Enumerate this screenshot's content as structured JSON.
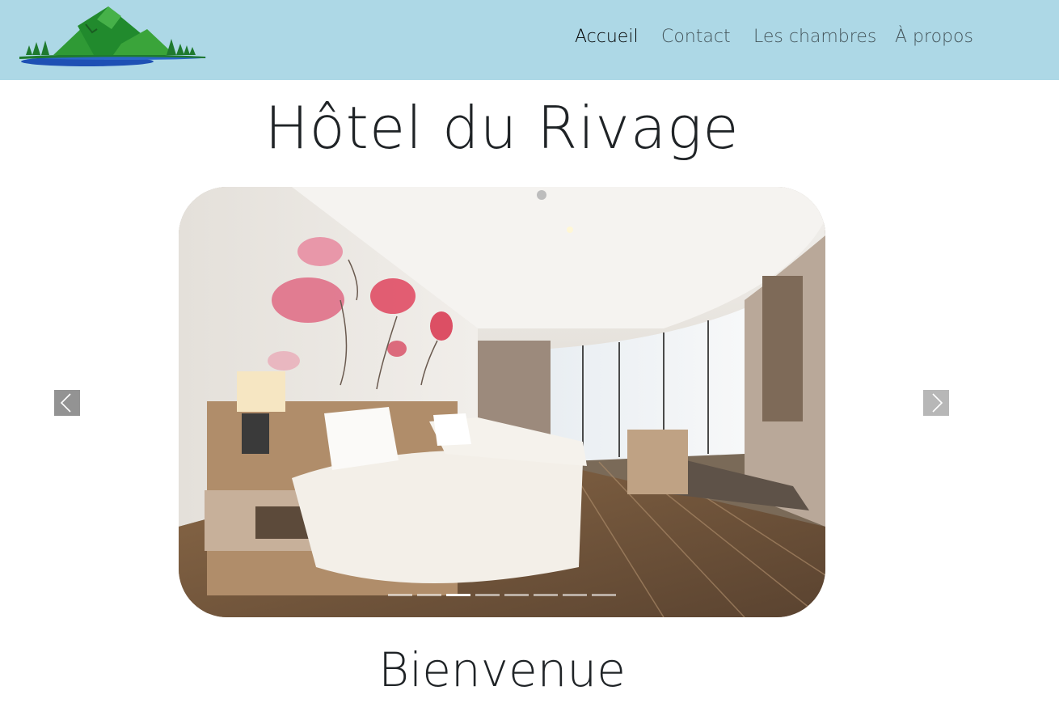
{
  "header": {
    "logo": {
      "icon": "mountain-lake-logo",
      "colors": {
        "mountain": "#2e8b2e",
        "water": "#1e50b4",
        "trees": "#1f7a2e"
      }
    },
    "nav": [
      {
        "label": "Accueil",
        "active": true
      },
      {
        "label": "Contact",
        "active": false
      },
      {
        "label": "Les chambres",
        "active": false
      },
      {
        "label": "À propos",
        "active": false
      }
    ],
    "background": "#add8e6"
  },
  "main": {
    "title": "Hôtel du Rivage",
    "carousel": {
      "slide_count": 8,
      "active_index": 2,
      "prev_icon": "chevron-left-icon",
      "next_icon": "chevron-right-icon"
    },
    "welcome_heading": "Bienvenue"
  }
}
